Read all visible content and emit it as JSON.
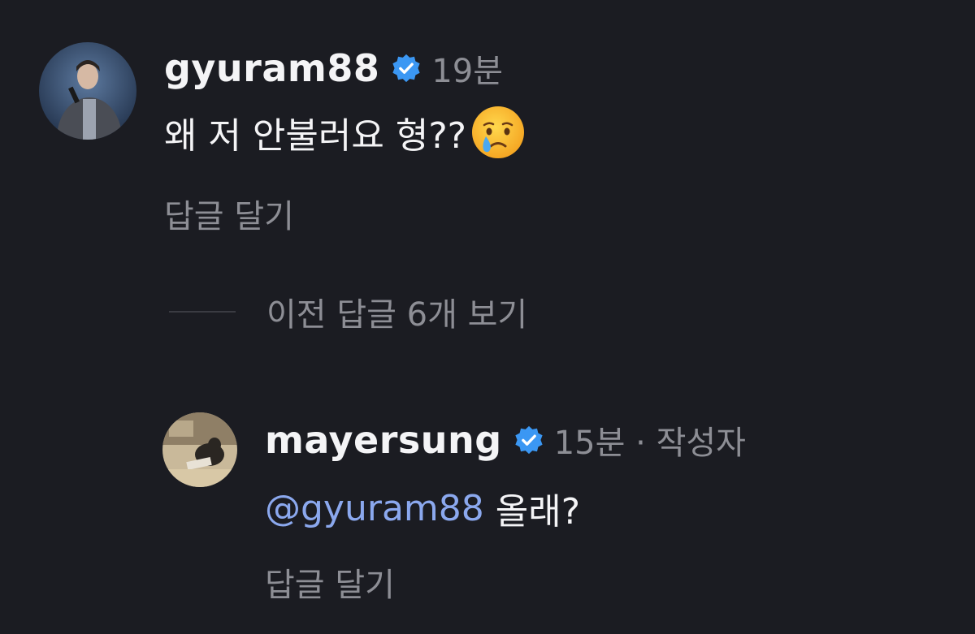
{
  "comments": [
    {
      "username": "gyuram88",
      "time": "19분",
      "text": "왜 저 안불러요 형??",
      "emoji": "crying-face",
      "reply_label": "답글 달기"
    },
    {
      "username": "mayersung",
      "time": "15분 · 작성자",
      "mention": "@gyuram88",
      "text": " 올래?",
      "reply_label": "답글 달기"
    }
  ],
  "view_replies_label": "이전 답글 6개 보기",
  "colors": {
    "background": "#1b1c22",
    "verified_badge": "#3b97f3",
    "mention": "#8ba8ee",
    "secondary_text": "#8d8e95"
  }
}
